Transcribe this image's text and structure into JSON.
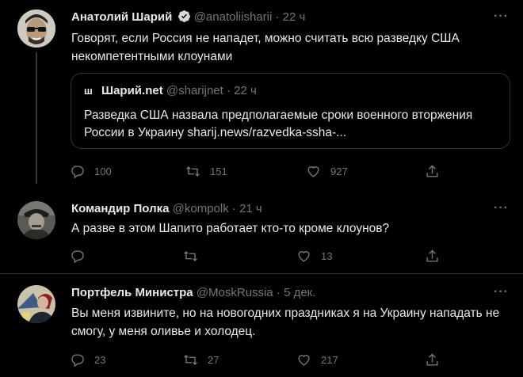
{
  "tweets": [
    {
      "author": "Анатолий Шарий",
      "handle": "@anatoliisharii",
      "time": "22 ч",
      "text": "Говорят, если Россия не нападет, можно считать всю разведку США некомпетентными клоунами",
      "quote": {
        "logo": "ш",
        "author": "Шарий.net",
        "handle": "@sharijnet",
        "time": "22 ч",
        "text": "Разведка США назвала предполагаемые сроки военного вторжения России в Украину sharij.news/razvedka-ssha-..."
      },
      "replies": "100",
      "retweets": "151",
      "likes": "927",
      "more": "···"
    },
    {
      "author": "Командир Полка",
      "handle": "@kompolk",
      "time": "21 ч",
      "text": "А разве в этом Шапито работает кто-то кроме клоунов?",
      "replies": "",
      "retweets": "",
      "likes": "13",
      "more": "···"
    },
    {
      "author": "Портфель Министра",
      "handle": "@MoskRussia",
      "time": "5 дек.",
      "text": "Вы меня извините, но на новогодних праздниках я на Украину нападать не смогу, у меня оливье и холодец.",
      "replies": "23",
      "retweets": "27",
      "likes": "217",
      "more": "···"
    }
  ],
  "separator": "·",
  "colors": {
    "background": "#000000",
    "text": "#e7e9ea",
    "muted": "#71767b",
    "border": "#2f3336",
    "verified": "#1d9bf0"
  },
  "icons": [
    "reply-icon",
    "retweet-icon",
    "like-icon",
    "share-icon",
    "verified-badge-icon",
    "more-icon"
  ]
}
